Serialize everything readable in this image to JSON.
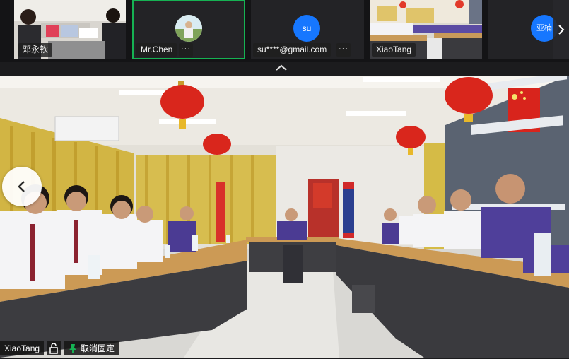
{
  "participants": [
    {
      "name": "邓永钦",
      "type": "video"
    },
    {
      "name": "Mr.Chen",
      "type": "avatar-photo"
    },
    {
      "name": "su****@gmail.com",
      "type": "avatar-initials",
      "initials": "su"
    },
    {
      "name": "XiaoTang",
      "type": "video"
    },
    {
      "name": "",
      "type": "avatar-initials",
      "initials": "亚楠"
    }
  ],
  "main_view": {
    "speaker_name": "XiaoTang",
    "unpin_label": "取消固定"
  },
  "colors": {
    "accent_green": "#16b253",
    "avatar_blue": "#1677ff",
    "bar_bg": "#141416"
  }
}
